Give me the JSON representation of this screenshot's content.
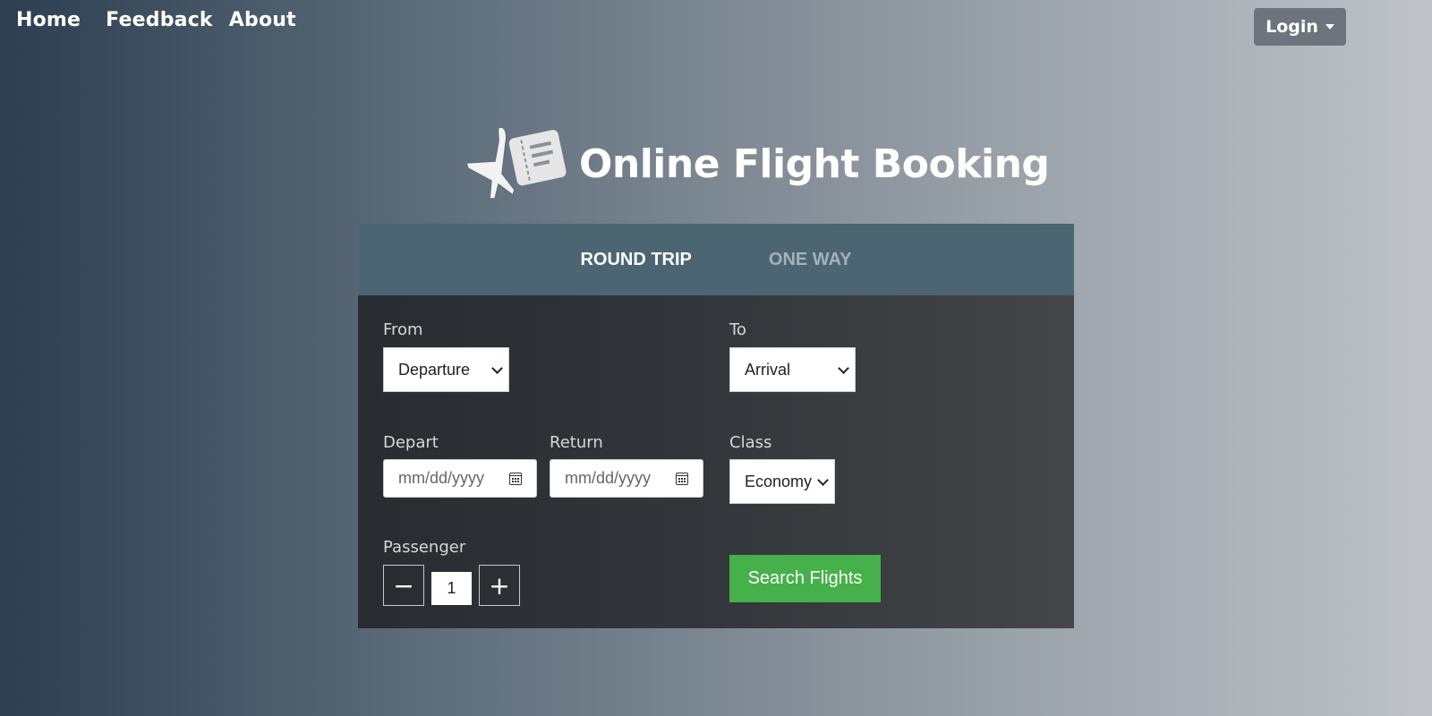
{
  "nav": {
    "home": "Home",
    "feedback": "Feedback",
    "about": "About"
  },
  "login": {
    "label": "Login"
  },
  "brand": {
    "title": "Online Flight Booking",
    "logo_icon": "airplane-ticket-icon"
  },
  "tabs": [
    {
      "label": "ROUND TRIP",
      "active": true
    },
    {
      "label": "ONE WAY",
      "active": false
    }
  ],
  "form": {
    "from_label": "From",
    "from_value": "Departure",
    "to_label": "To",
    "to_value": "Arrival",
    "depart_label": "Depart",
    "depart_placeholder": "mm/dd/yyyy",
    "return_label": "Return",
    "return_placeholder": "mm/dd/yyyy",
    "class_label": "Class",
    "class_value": "Economy",
    "passenger_label": "Passenger",
    "passenger_value": "1",
    "minus": "−",
    "plus": "+",
    "search_label": "Search Flights"
  },
  "colors": {
    "accent_green": "#46b04a",
    "tab_bar": "#4b6672",
    "login_button": "#6c757d"
  }
}
